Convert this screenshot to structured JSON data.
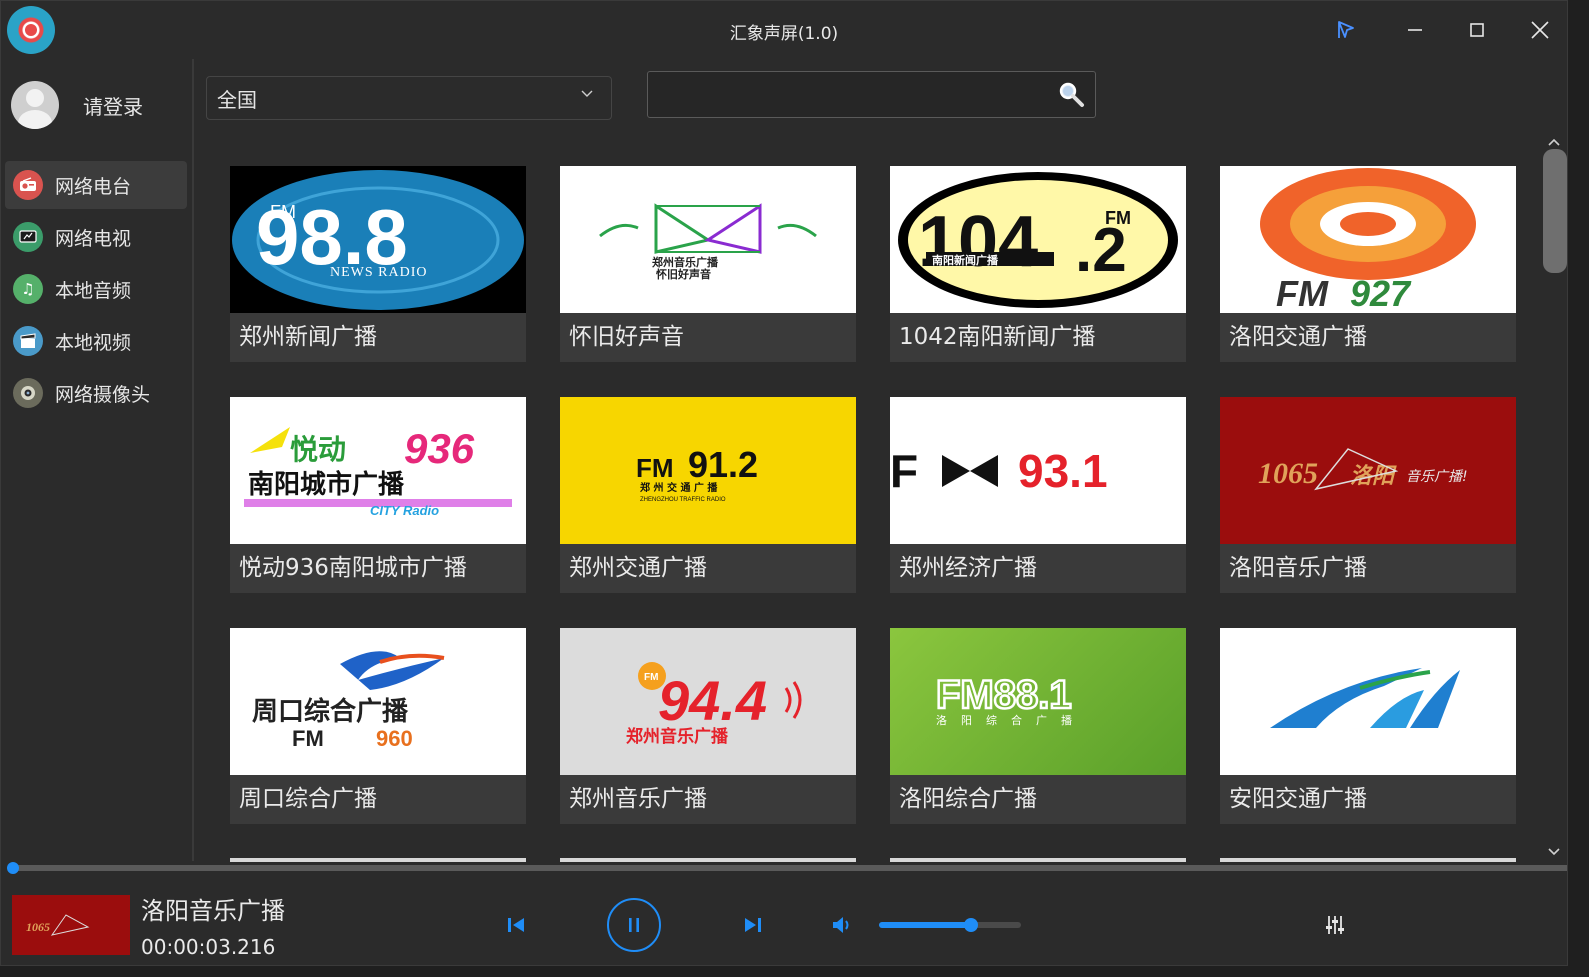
{
  "window": {
    "title": "汇象声屏(1.0)"
  },
  "sidebar": {
    "login_label": "请登录",
    "items": [
      {
        "label": "网络电台",
        "icon": "radio-icon",
        "active": true
      },
      {
        "label": "网络电视",
        "icon": "tv-icon",
        "active": false
      },
      {
        "label": "本地音频",
        "icon": "music-note-icon",
        "active": false
      },
      {
        "label": "本地视频",
        "icon": "clapperboard-icon",
        "active": false
      },
      {
        "label": "网络摄像头",
        "icon": "webcam-icon",
        "active": false
      }
    ]
  },
  "filters": {
    "region_value": "全国",
    "search_value": ""
  },
  "stations": [
    {
      "name": "郑州新闻广播",
      "logo_text": "FM 98.8 NEWS RADIO"
    },
    {
      "name": "怀旧好声音",
      "logo_text": "郑州音乐广播 怀旧好声音"
    },
    {
      "name": "1042南阳新闻广播",
      "logo_text": "104.2 FM 南阳新闻广播"
    },
    {
      "name": "洛阳交通广播",
      "logo_text": "FM927"
    },
    {
      "name": "悦动936南阳城市广播",
      "logo_text": "悦动936 南阳城市广播 CITY Radio"
    },
    {
      "name": "郑州交通广播",
      "logo_text": "FM 91.2 郑州交通广播 ZHENGZHOU TRAFFIC RADIO"
    },
    {
      "name": "郑州经济广播",
      "logo_text": "FM 93.1"
    },
    {
      "name": "洛阳音乐广播",
      "logo_text": "1065 洛阳音乐广播"
    },
    {
      "name": "周口综合广播",
      "logo_text": "周口综合广播 FM 960"
    },
    {
      "name": "郑州音乐广播",
      "logo_text": "FM 94.4 郑州音乐广播"
    },
    {
      "name": "洛阳综合广播",
      "logo_text": "FM88.1 洛阳综合广播"
    },
    {
      "name": "安阳交通广播",
      "logo_text": ""
    }
  ],
  "player": {
    "now_playing": "洛阳音乐广播",
    "elapsed": "00:00:03.216",
    "progress": 0.0,
    "volume": 0.65,
    "state": "playing"
  },
  "colors": {
    "accent": "#1f8df7",
    "background": "#2b2b2b",
    "card": "#3a3a3a"
  }
}
